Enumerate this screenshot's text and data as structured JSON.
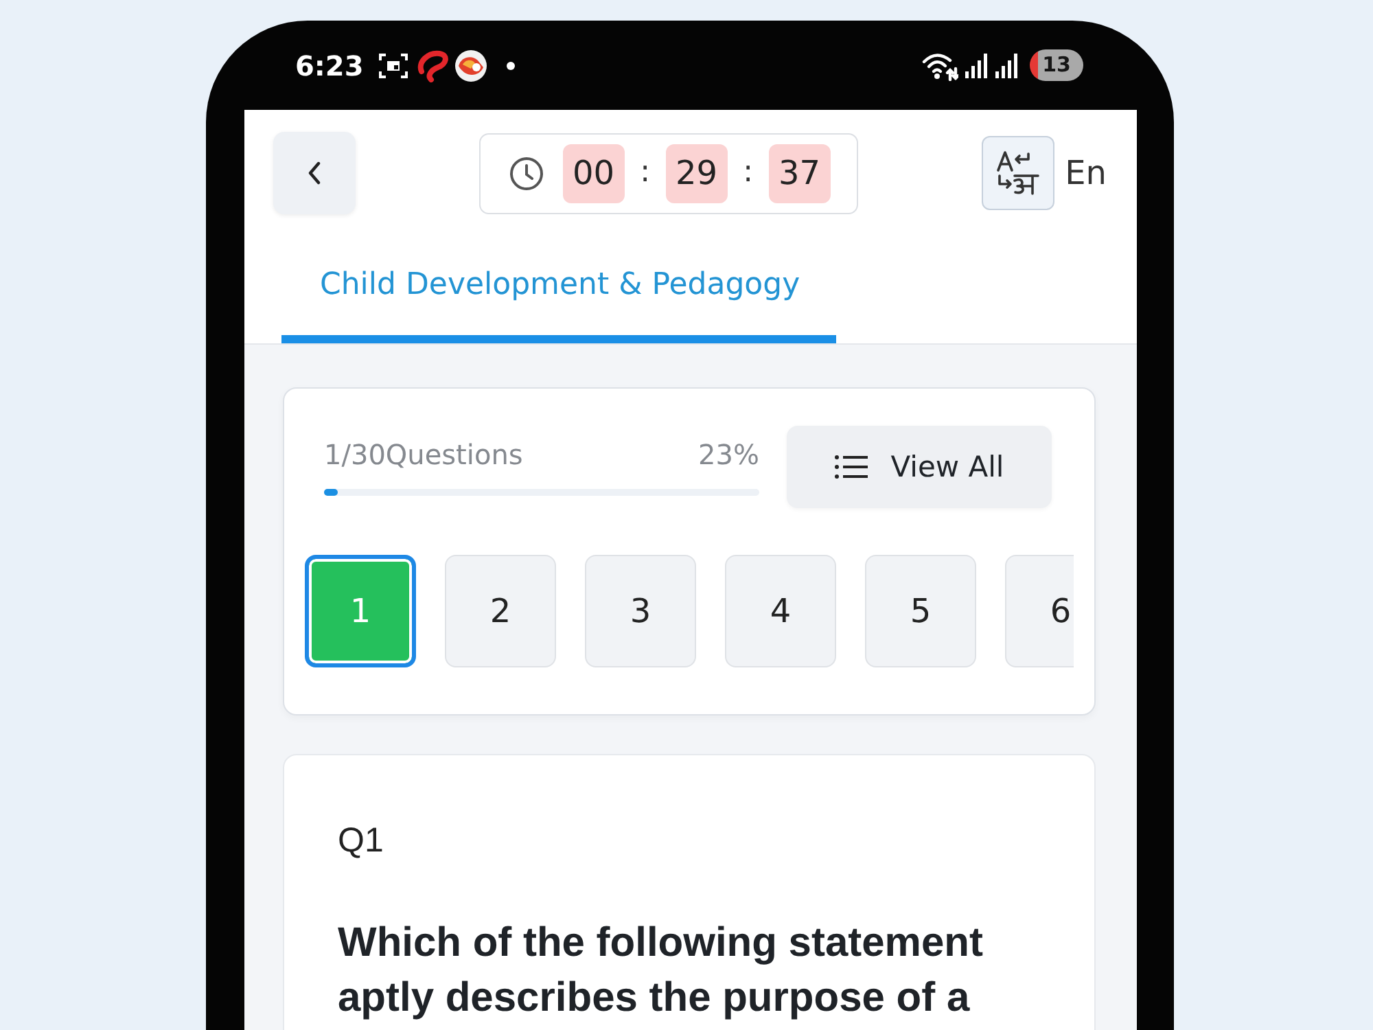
{
  "status_bar": {
    "time": "6:23",
    "battery": "13"
  },
  "header": {
    "timer": [
      {
        "kind": "digits",
        "text": "00"
      },
      {
        "kind": "separator",
        "text": ":"
      },
      {
        "kind": "digits",
        "text": "29"
      },
      {
        "kind": "separator",
        "text": ":"
      },
      {
        "kind": "digits",
        "text": "37"
      }
    ],
    "language": "En"
  },
  "tabs": [
    {
      "label": "Child Development & Pedagogy",
      "selected": true
    }
  ],
  "progress": {
    "count": "1/30Questions",
    "percent": "23%",
    "level": 0.03
  },
  "view_all_button": {
    "label": "View All"
  },
  "question_tiles": [
    {
      "label": "1",
      "selected": true
    },
    {
      "label": "2",
      "selected": false
    },
    {
      "label": "3",
      "selected": false
    },
    {
      "label": "4",
      "selected": false
    },
    {
      "label": "5",
      "selected": false
    },
    {
      "label": "6",
      "selected": false
    }
  ],
  "question": {
    "number": "Q1",
    "text": "Which of the following statement aptly describes the purpose of a"
  }
}
